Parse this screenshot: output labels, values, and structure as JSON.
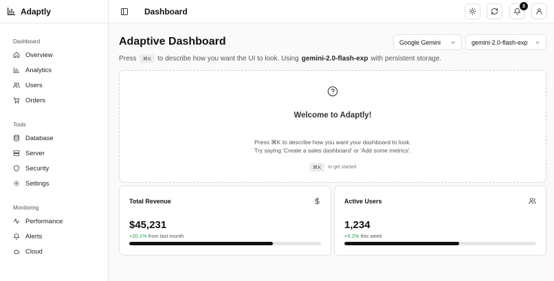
{
  "brand": {
    "name": "Adaptly"
  },
  "sidebar": {
    "sections": [
      {
        "label": "Dashboard",
        "items": [
          {
            "label": "Overview",
            "icon": "home-icon"
          },
          {
            "label": "Analytics",
            "icon": "bar-chart-icon"
          },
          {
            "label": "Users",
            "icon": "users-icon"
          },
          {
            "label": "Orders",
            "icon": "cart-icon"
          }
        ]
      },
      {
        "label": "Tools",
        "items": [
          {
            "label": "Database",
            "icon": "database-icon"
          },
          {
            "label": "Server",
            "icon": "server-icon"
          },
          {
            "label": "Security",
            "icon": "shield-icon"
          },
          {
            "label": "Settings",
            "icon": "gear-icon"
          }
        ]
      },
      {
        "label": "Monitoring",
        "items": [
          {
            "label": "Performance",
            "icon": "activity-icon"
          },
          {
            "label": "Alerts",
            "icon": "bell-icon"
          },
          {
            "label": "Cloud",
            "icon": "cloud-icon"
          }
        ]
      }
    ]
  },
  "header": {
    "title": "Dashboard",
    "notification_count": "3",
    "icons": [
      "sidebar-toggle-icon",
      "sun-icon",
      "refresh-icon",
      "bell-icon",
      "user-icon"
    ]
  },
  "main": {
    "heading": "Adaptive Dashboard",
    "subtitle": {
      "prefix": "Press",
      "shortcut": "⌘K",
      "middle": "to describe how you want the UI to look. Using",
      "model": "gemini-2.0-flash-exp",
      "suffix": "with persistent storage."
    },
    "provider_select": {
      "value": "Google Gemini"
    },
    "model_select": {
      "value": "gemini-2.0-flash-exp"
    },
    "welcome": {
      "title": "Welcome to Adaptly!",
      "line1": "Press ⌘K to describe how you want your dashboard to look.",
      "line2": "Try saying 'Create a sales dashboard' or 'Add some metrics'.",
      "hint_key": "⌘K",
      "hint_text": "to get started"
    },
    "cards": [
      {
        "title": "Total Revenue",
        "icon": "dollar-icon",
        "value": "$45,231",
        "delta": "+20.1%",
        "delta_text": "from last month",
        "progress": 0.75
      },
      {
        "title": "Active Users",
        "icon": "users-icon",
        "value": "1,234",
        "delta": "+5.2%",
        "delta_text": "this week",
        "progress": 0.6
      }
    ]
  },
  "colors": {
    "accent": "#111111",
    "positive": "#16a34a",
    "border": "#e2e2e2",
    "muted": "#555555"
  }
}
